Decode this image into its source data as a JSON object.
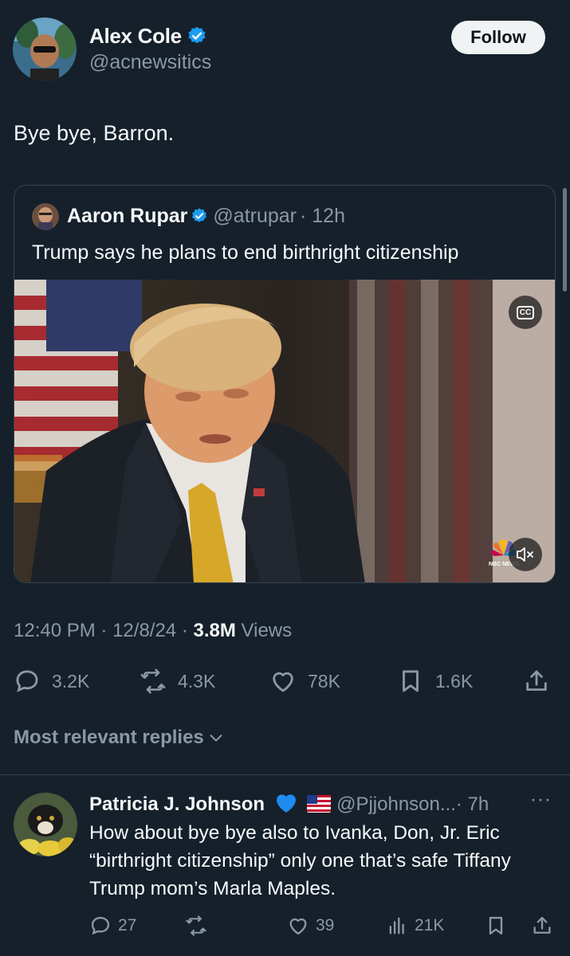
{
  "author": {
    "name": "Alex Cole",
    "handle": "@acnewsitics",
    "follow_label": "Follow"
  },
  "tweet": {
    "text": "Bye bye, Barron."
  },
  "quote": {
    "name": "Aaron Rupar",
    "handle": "@atrupar",
    "time": "· 12h",
    "text": "Trump says he plans to end birthright citizenship",
    "video": {
      "cc_label": "CC",
      "network_label": "NBC NEWS"
    }
  },
  "meta": {
    "time": "12:40 PM",
    "date": "12/8/24",
    "views_count": "3.8M",
    "views_label": "Views"
  },
  "actions": {
    "replies": "3.2K",
    "reposts": "4.3K",
    "likes": "78K",
    "bookmarks": "1.6K"
  },
  "sort": {
    "label": "Most relevant replies"
  },
  "reply": {
    "name": "Patricia J. Johnson",
    "handle": "@Pjjohnson...",
    "time": "· 7h",
    "more": "···",
    "text": "How about bye bye also to Ivanka, Don, Jr. Eric “birthright citizenship” only one that’s safe Tiffany Trump mom’s Marla Maples.",
    "actions": {
      "replies": "27",
      "likes": "39",
      "views": "21K"
    }
  },
  "colors": {
    "background": "#15202b",
    "accent": "#1d9bf0",
    "muted": "#8b98a5",
    "border": "#38444d"
  }
}
